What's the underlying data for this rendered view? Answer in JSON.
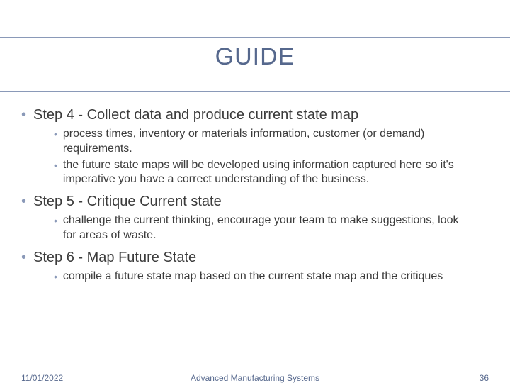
{
  "title": "GUIDE",
  "bullets": [
    {
      "label": "Step 4 - Collect data and produce current state map",
      "sub": [
        "process times, inventory or materials information, customer (or demand) requirements.",
        "the future state maps will be developed using information captured here so it's imperative you have a correct understanding of the business."
      ]
    },
    {
      "label": "Step 5 - Critique Current state",
      "sub": [
        "challenge the current thinking, encourage your team to make suggestions, look for areas of waste."
      ]
    },
    {
      "label": "Step 6 - Map Future State",
      "sub": [
        "compile a future state map based on the current state map and the critiques"
      ]
    }
  ],
  "footer": {
    "date": "11/01/2022",
    "center": "Advanced Manufacturing Systems",
    "page": "36"
  }
}
